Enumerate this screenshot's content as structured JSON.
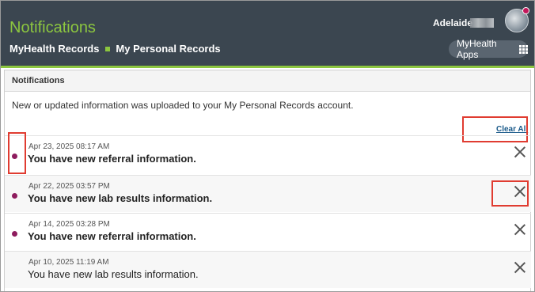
{
  "header": {
    "title": "Notifications",
    "crumb_home": "MyHealth Records",
    "crumb_current": "My Personal Records",
    "user_name": "Adelaide",
    "apps_label": "MyHealth Apps"
  },
  "panel": {
    "heading": "Notifications",
    "intro": "New or updated information was uploaded to your My Personal Records account.",
    "clear_all": "Clear All"
  },
  "notifications": [
    {
      "date": "Apr 23, 2025 08:17 AM",
      "message": "You have new referral information.",
      "unread": true
    },
    {
      "date": "Apr 22, 2025 03:57 PM",
      "message": "You have new lab results information.",
      "unread": true
    },
    {
      "date": "Apr 14, 2025 03:28 PM",
      "message": "You have new referral information.",
      "unread": true
    },
    {
      "date": "Apr 10, 2025 11:19 AM",
      "message": "You have new lab results information.",
      "unread": false
    }
  ],
  "colors": {
    "header_bg": "#3b4650",
    "brand_green": "#8cc63f",
    "unread_dot": "#8e1c5e",
    "highlight_red": "#e03c31",
    "link_blue": "#1a5a8a"
  },
  "icons": {
    "apps": "grid-icon",
    "close": "close-icon",
    "unread": "unread-dot-icon"
  }
}
